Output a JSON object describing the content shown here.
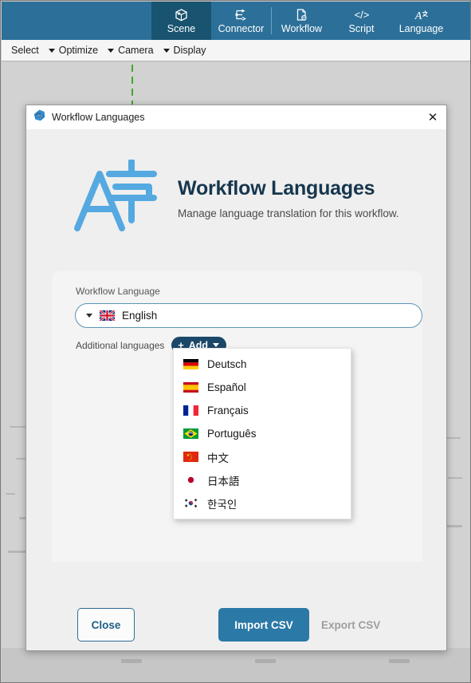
{
  "ribbon": {
    "tabs": [
      {
        "label": "Scene",
        "icon": "cube-icon",
        "active": true
      },
      {
        "label": "Connector",
        "icon": "connector-icon",
        "active": false
      },
      {
        "label": "Workflow",
        "icon": "document-gear-icon",
        "active": false
      },
      {
        "label": "Script",
        "icon": "code-brackets-icon",
        "active": false
      },
      {
        "label": "Language",
        "icon": "translate-a-icon",
        "active": false
      }
    ]
  },
  "menubar": {
    "items": [
      {
        "label": "Select",
        "has_caret": false
      },
      {
        "label": "Optimize",
        "has_caret": true
      },
      {
        "label": "Camera",
        "has_caret": true
      },
      {
        "label": "Display",
        "has_caret": true
      }
    ]
  },
  "dialog": {
    "titlebar": {
      "icon": "app-logo-icon",
      "title": "Workflow Languages",
      "close_label": "✕"
    },
    "hero": {
      "icon": "translate-a-zi-icon",
      "title": "Workflow Languages",
      "subtitle": "Manage language translation for this workflow."
    },
    "form": {
      "workflow_language_label": "Workflow Language",
      "workflow_language_value": "English",
      "workflow_language_flag": "flag-gb",
      "additional_languages_label": "Additional languages",
      "add_button_label": "Add",
      "add_button_plus": "+"
    },
    "dropdown": {
      "options": [
        {
          "label": "Deutsch",
          "flag": "flag-de"
        },
        {
          "label": "Español",
          "flag": "flag-es"
        },
        {
          "label": "Français",
          "flag": "flag-fr"
        },
        {
          "label": "Português",
          "flag": "flag-br"
        },
        {
          "label": "中文",
          "flag": "flag-cn"
        },
        {
          "label": "日本語",
          "flag": "flag-jp"
        },
        {
          "label": "한국인",
          "flag": "flag-kr"
        }
      ]
    },
    "footer": {
      "close_label": "Close",
      "import_label": "Import CSV",
      "export_label": "Export CSV",
      "export_disabled": true
    }
  },
  "colors": {
    "ribbon_blue": "#2c7099",
    "ribbon_active": "#18536f",
    "primary_button": "#2b79a6",
    "add_button": "#1b4868",
    "hero_title": "#16364d",
    "hero_icon": "#55a9e0",
    "disabled_text": "#9e9e9e",
    "canvas": "#d2d2d2",
    "guide_green": "#3ea82a"
  }
}
